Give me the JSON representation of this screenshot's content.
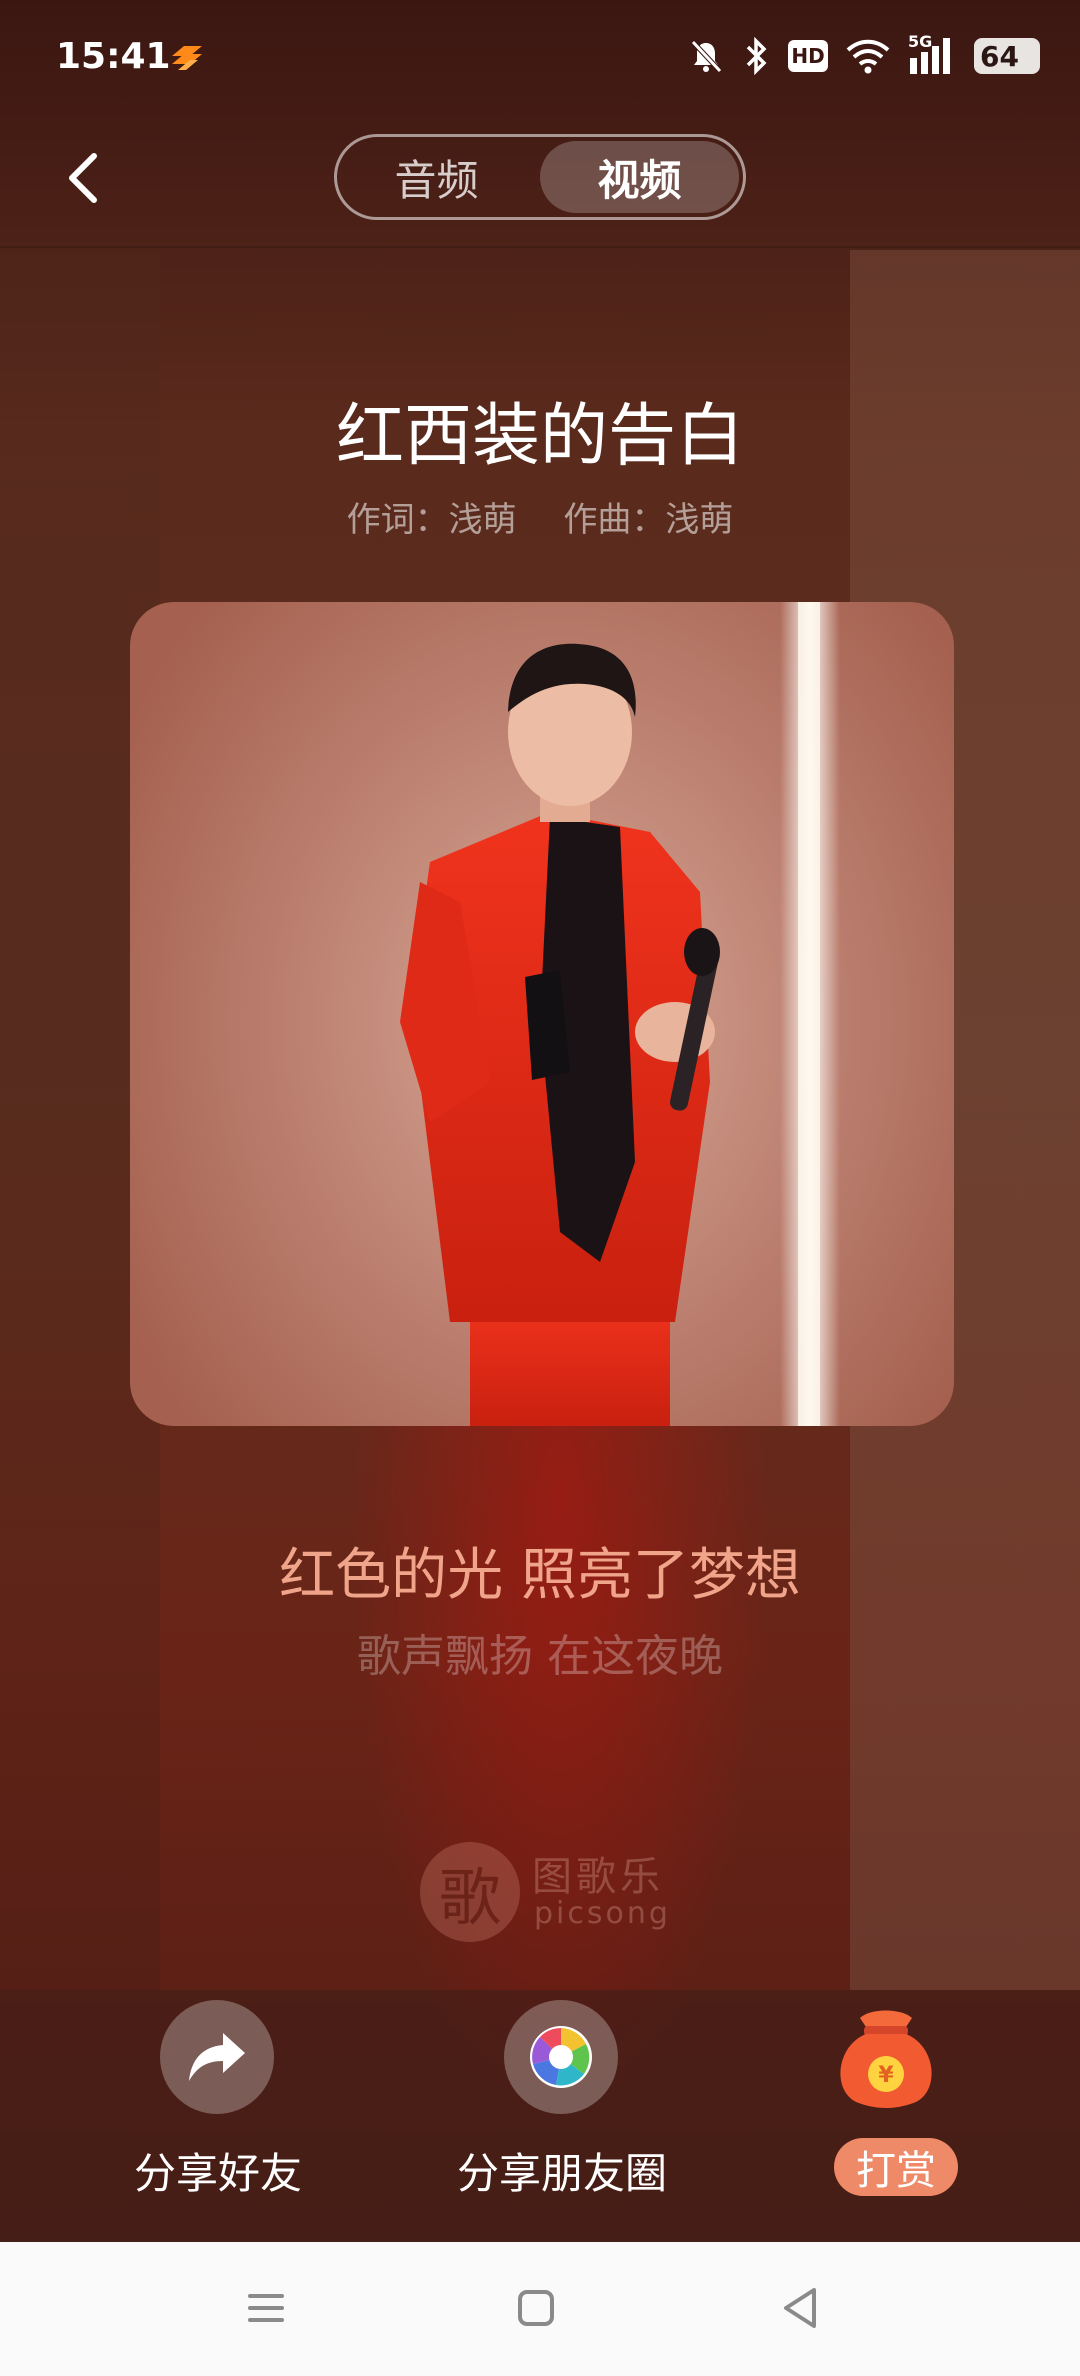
{
  "status_bar": {
    "time": "15:41",
    "hd_label": "HD",
    "network_label": "5G",
    "battery_level": "64"
  },
  "header": {
    "tabs": [
      {
        "label": "音频",
        "active": false
      },
      {
        "label": "视频",
        "active": true
      }
    ]
  },
  "song": {
    "title": "红西装的告白",
    "lyricist": "作词：浅萌",
    "composer": "作曲：浅萌"
  },
  "lyrics": {
    "current": "红色的光 照亮了梦想",
    "next": "歌声飘扬 在这夜晚"
  },
  "watermark": {
    "logo_char": "歌",
    "name_cn": "图歌乐",
    "name_en": "picsong"
  },
  "actions": [
    {
      "label": "分享好友",
      "icon": "share-arrow-icon"
    },
    {
      "label": "分享朋友圈",
      "icon": "moments-aperture-icon"
    },
    {
      "label": "打赏",
      "icon": "money-bag-icon"
    }
  ],
  "reward_icon_symbol": "¥",
  "colors": {
    "accent": "#f0a48a",
    "reward": "#ef8a68",
    "suit_red": "#e02a18"
  }
}
